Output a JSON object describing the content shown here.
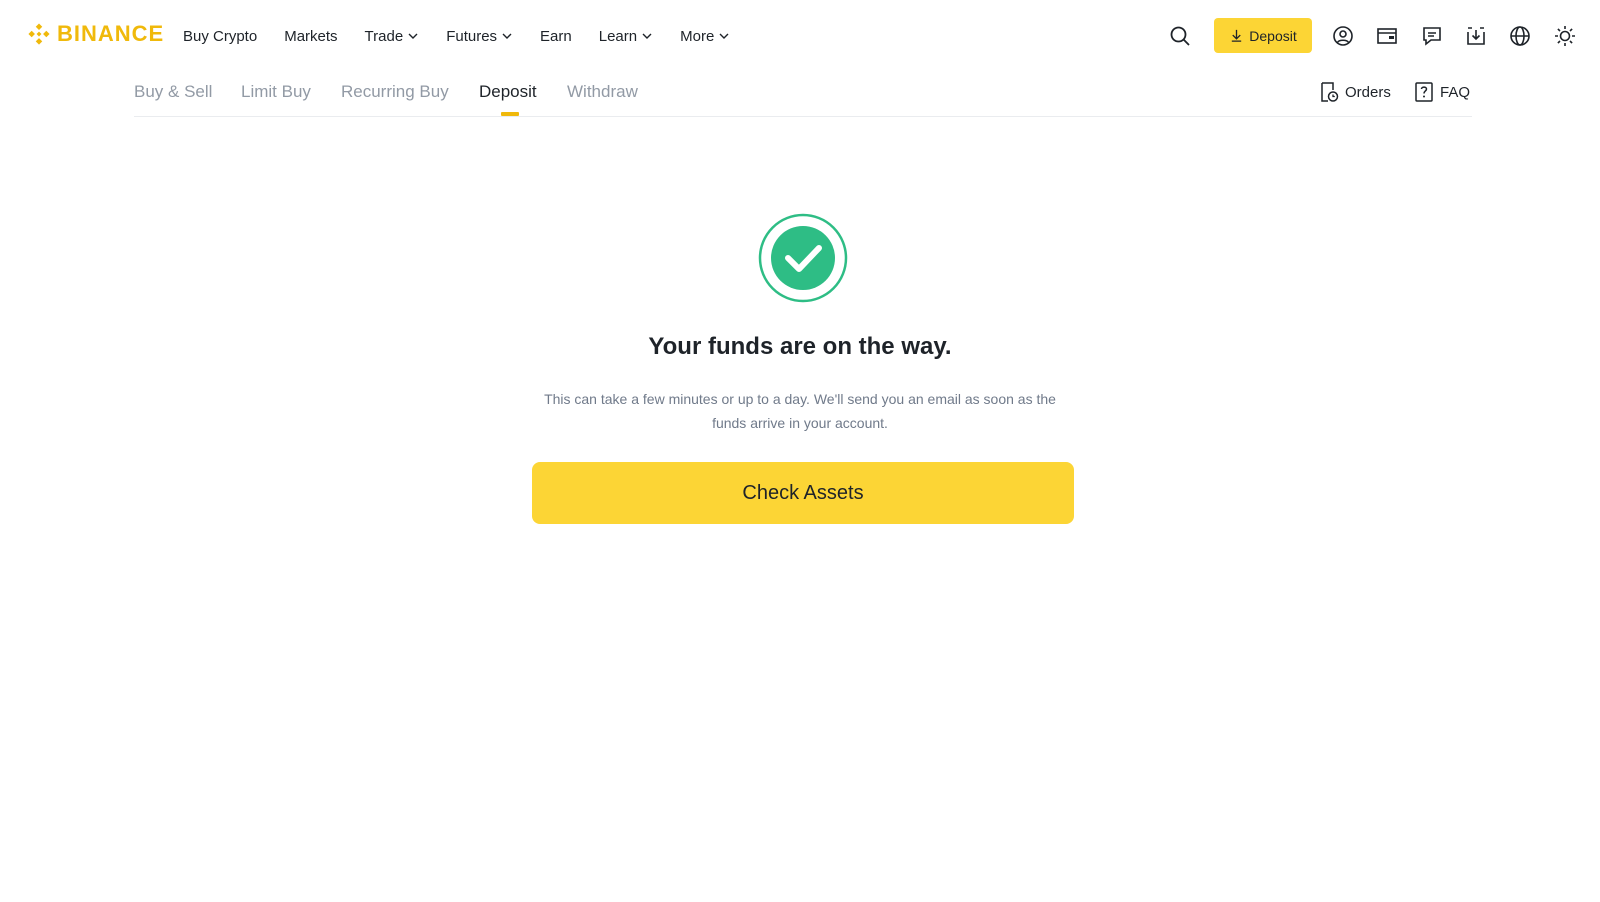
{
  "brand": {
    "name": "BINANCE",
    "color": "#f0b90b"
  },
  "nav": {
    "items": [
      {
        "label": "Buy Crypto",
        "dropdown": false
      },
      {
        "label": "Markets",
        "dropdown": false
      },
      {
        "label": "Trade",
        "dropdown": true
      },
      {
        "label": "Futures",
        "dropdown": true
      },
      {
        "label": "Earn",
        "dropdown": false
      },
      {
        "label": "Learn",
        "dropdown": true
      },
      {
        "label": "More",
        "dropdown": true
      }
    ]
  },
  "header_actions": {
    "deposit_label": "Deposit",
    "icons": [
      "search-icon",
      "download-icon",
      "user-icon",
      "wallet-icon",
      "message-icon",
      "download-tray-icon",
      "globe-icon",
      "sun-icon"
    ]
  },
  "tabs": [
    {
      "label": "Buy & Sell",
      "active": false
    },
    {
      "label": "Limit Buy",
      "active": false
    },
    {
      "label": "Recurring Buy",
      "active": false
    },
    {
      "label": "Deposit",
      "active": true
    },
    {
      "label": "Withdraw",
      "active": false
    }
  ],
  "right_links": {
    "orders": "Orders",
    "faq": "FAQ"
  },
  "success": {
    "title": "Your funds are on the way.",
    "description": "This can take a few minutes or up to a day. We'll send you an email as soon as the funds arrive in your account.",
    "button_label": "Check Assets"
  },
  "colors": {
    "accent": "#fcd535",
    "success": "#2ebd85",
    "text": "#1e2329",
    "muted": "#929aa5"
  }
}
